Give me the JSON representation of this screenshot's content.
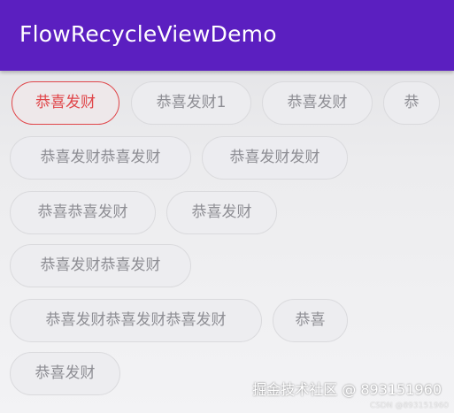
{
  "app_bar": {
    "title": "FlowRecycleViewDemo",
    "color": "#5b1fc0"
  },
  "tags": [
    {
      "label": "恭喜发财",
      "selected": true
    },
    {
      "label": "恭喜发财1",
      "selected": false
    },
    {
      "label": "恭喜发财",
      "selected": false
    },
    {
      "label": "恭",
      "selected": false
    },
    {
      "label": "恭喜发财恭喜发财",
      "selected": false
    },
    {
      "label": "恭喜发财发财",
      "selected": false
    },
    {
      "label": "恭喜恭喜发财",
      "selected": false
    },
    {
      "label": "恭喜发财",
      "selected": false
    },
    {
      "label": "恭喜发财恭喜发财",
      "selected": false
    },
    {
      "label": "恭喜发财恭喜发财恭喜发财",
      "selected": false
    },
    {
      "label": "恭喜",
      "selected": false
    },
    {
      "label": "恭喜发财",
      "selected": false
    }
  ],
  "colors": {
    "selected": "#e0464a",
    "unselected_text": "#8e8e94"
  },
  "watermark": {
    "text": "掘金技术社区 @ 893151960",
    "sub": "CSDN @893151960"
  }
}
